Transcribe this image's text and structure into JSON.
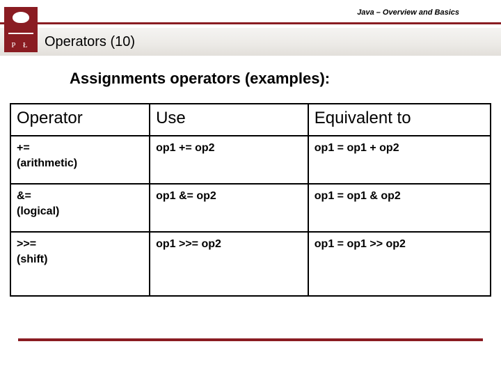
{
  "header": {
    "topic": "Java – Overview and Basics",
    "logo_letters": "P  Ł"
  },
  "title": "Operators (10)",
  "heading": "Assignments operators (examples):",
  "table": {
    "columns": [
      "Operator",
      "Use",
      "Equivalent to"
    ],
    "rows": [
      {
        "operator": "+=",
        "operator_note": "(arithmetic)",
        "use": "op1 += op2",
        "equiv": "op1 = op1 + op2"
      },
      {
        "operator": "&=",
        "operator_note": "(logical)",
        "use": "op1 &= op2",
        "equiv": "op1 = op1 & op2"
      },
      {
        "operator": ">>=",
        "operator_note": "(shift)",
        "use": "op1 >>= op2",
        "equiv": "op1 = op1 >> op2"
      }
    ]
  },
  "colors": {
    "accent": "#8a1c22"
  }
}
